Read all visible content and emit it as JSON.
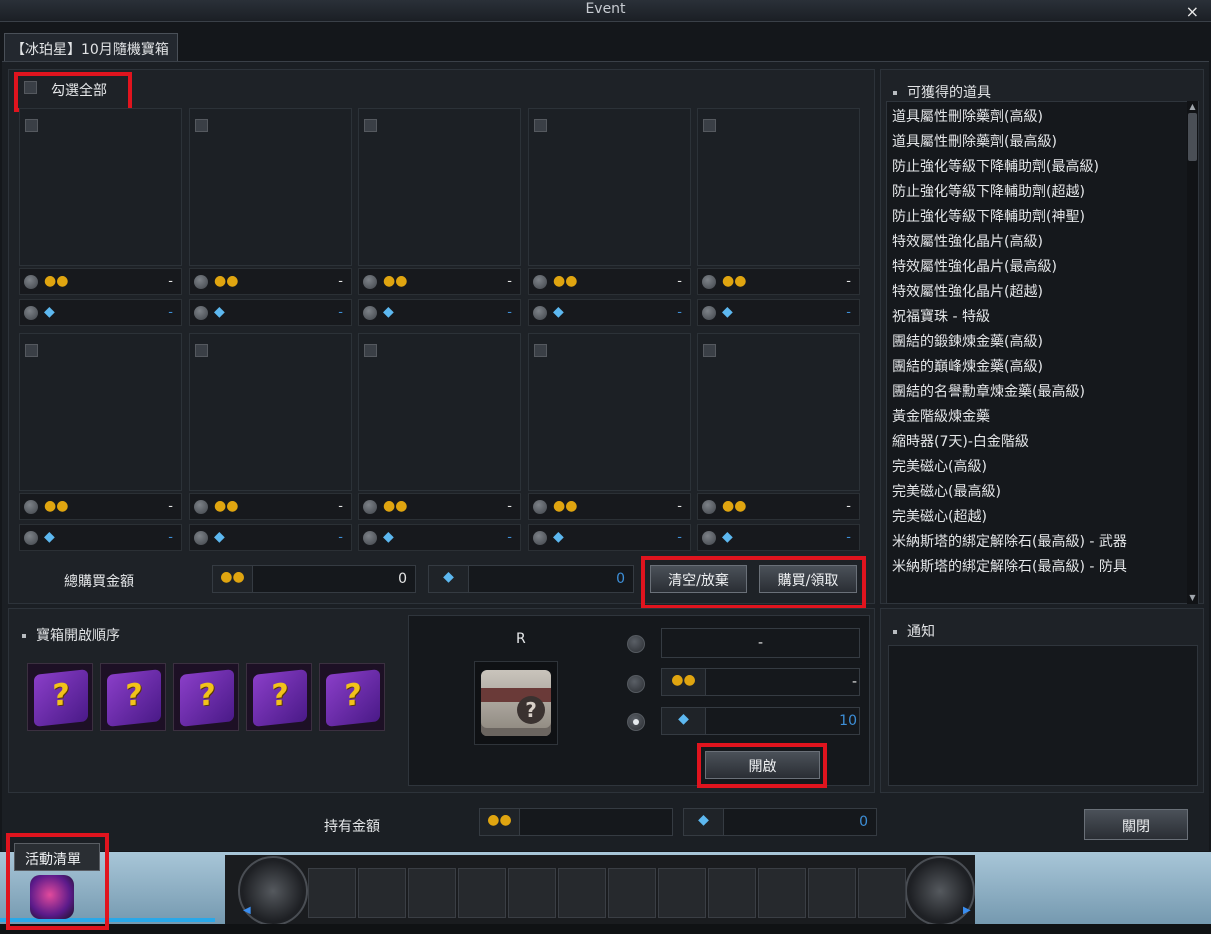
{
  "window": {
    "title": "Event",
    "close_glyph": "×"
  },
  "tab": {
    "label": "【冰珀星】10月隨機寶箱"
  },
  "select_all": {
    "label": "勾選全部"
  },
  "slots": [
    {
      "gold": "-",
      "diamond": "-"
    },
    {
      "gold": "-",
      "diamond": "-"
    },
    {
      "gold": "-",
      "diamond": "-"
    },
    {
      "gold": "-",
      "diamond": "-"
    },
    {
      "gold": "-",
      "diamond": "-"
    },
    {
      "gold": "-",
      "diamond": "-"
    },
    {
      "gold": "-",
      "diamond": "-"
    },
    {
      "gold": "-",
      "diamond": "-"
    },
    {
      "gold": "-",
      "diamond": "-"
    },
    {
      "gold": "-",
      "diamond": "-"
    }
  ],
  "purchase": {
    "total_label": "總購買金額",
    "gold_total": "0",
    "diamond_total": "0",
    "clear_button": "清空/放棄",
    "buy_button": "購買/領取"
  },
  "items_panel": {
    "title": "可獲得的道具",
    "items": [
      "道具屬性刪除藥劑(高級)",
      "道具屬性刪除藥劑(最高級)",
      "防止強化等級下降輔助劑(最高級)",
      "防止強化等級下降輔助劑(超越)",
      "防止強化等級下降輔助劑(神聖)",
      "特效屬性強化晶片(高級)",
      "特效屬性強化晶片(最高級)",
      "特效屬性強化晶片(超越)",
      "祝福寶珠 - 特級",
      "團結的鍛鍊煉金藥(高級)",
      "團結的巔峰煉金藥(高級)",
      "團結的名譽勳章煉金藥(最高級)",
      "黃金階級煉金藥",
      "縮時器(7天)-白金階級",
      "完美磁心(高級)",
      "完美磁心(最高級)",
      "完美磁心(超越)",
      "米納斯塔的綁定解除石(最高級) - 武器",
      "米納斯塔的綁定解除石(最高級) - 防具"
    ]
  },
  "open_order": {
    "title": "寶箱開啟順序",
    "box_glyph": "?",
    "box_count": 5
  },
  "open_panel": {
    "grade": "R",
    "option_text": "-",
    "gold_value": "-",
    "diamond_value": "10",
    "selected_option": 3,
    "open_button": "開啟"
  },
  "notice": {
    "title": "通知"
  },
  "holdings": {
    "label": "持有金額",
    "gold": "",
    "diamond": "0"
  },
  "close_button": "關閉",
  "activity": {
    "tab_label": "活動清單"
  },
  "icons": {
    "gold": "gold-coins-icon",
    "diamond": "diamond-icon"
  },
  "colors": {
    "highlight": "#e0141e",
    "diamond_value": "#3d8fd8",
    "gold_icon": "#e0a510",
    "diamond_icon": "#5db8f0"
  }
}
